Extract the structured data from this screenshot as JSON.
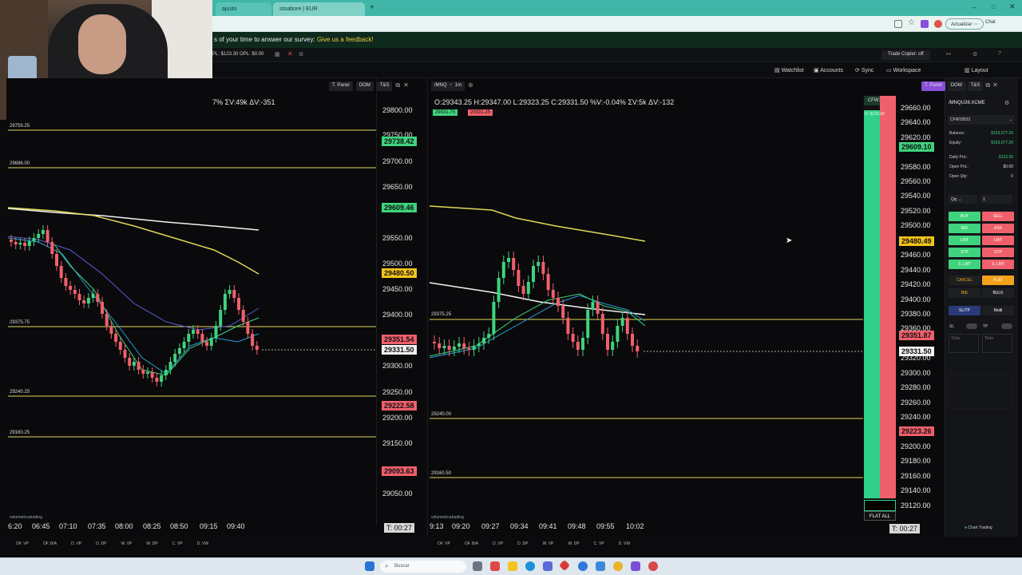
{
  "browser": {
    "tab1_label": "ajusto",
    "tab2_label": "stoabore | EUR",
    "address_buttons": [
      "Actualizar",
      "Chat"
    ]
  },
  "survey": {
    "prefix": "s of your time to answer our survey:",
    "link": "Give us a feedback!"
  },
  "topbar": {
    "opl_text": "PL: $123.30   OPL: $0.00",
    "trade_copier": "Trade Copier: off"
  },
  "toolbar": {
    "watchlist": "Watchlist",
    "accounts": "Accounts",
    "sync": "Sync",
    "workspace": "Workspace",
    "layout": "Layout"
  },
  "left_chart": {
    "tools": [
      "T. Panel",
      "DOM",
      "T&S"
    ],
    "ohlc": "7% ΣV:49k ΔV:-351",
    "yticks": [
      "29800.00",
      "29750.00",
      "29700.00",
      "29650.00",
      "29550.00",
      "29500.00",
      "29450.00",
      "29400.00",
      "29300.00",
      "29250.00",
      "29200.00",
      "29150.00",
      "29050.00"
    ],
    "badges": {
      "b1": "29738.42",
      "b2": "29609.46",
      "b3": "29480.50",
      "b4": "29351.54",
      "b5": "29331.50",
      "b6": "29222.58",
      "b7": "29093.63"
    },
    "hlines": {
      "l1": "29759.25",
      "l2": "29686.00",
      "l3": "29375.75",
      "l4": "29240.25",
      "l5": "29160.25"
    },
    "xticks": [
      "6:20",
      "06:45",
      "07:10",
      "07:35",
      "08:00",
      "08:25",
      "08:50",
      "09:15",
      "09:40"
    ],
    "timer": "T: 00:27",
    "brand": "volumetricatrading",
    "bottom": [
      "OF. VP",
      "OF. B/A",
      "D. VP",
      "D. DP",
      "W. VP",
      "W. DP",
      "C. VP",
      "D. VW"
    ]
  },
  "right_chart": {
    "symbol": "/MNQ",
    "interval": "1m",
    "ohlc": "O:29343.25  H:29347.00  L:29323.25  C:29331.50  %V:-0.04%  ΣV:5k  ΔV:-132",
    "bid": "29331.75",
    "ask": "29331.25",
    "yticks": [
      "29660.00",
      "29640.00",
      "29620.00",
      "29580.00",
      "29560.00",
      "29540.00",
      "29520.00",
      "29500.00",
      "29460.00",
      "29440.00",
      "29420.00",
      "29400.00",
      "29380.00",
      "29360.00",
      "29320.00",
      "29300.00",
      "29280.00",
      "29260.00",
      "29240.00",
      "29220.00",
      "29200.00",
      "29180.00",
      "29160.00",
      "29140.00",
      "29120.00"
    ],
    "badges": {
      "b1": "29609.10",
      "b2": "29480.49",
      "b3": "29351.87",
      "b4": "29331.50",
      "b5": "29223.26"
    },
    "hlines": {
      "l1": "29375.25",
      "l2": "29240.00",
      "l3": "29160.50"
    },
    "xticks": [
      "9:13",
      "09:20",
      "09:27",
      "09:34",
      "09:41",
      "09:48",
      "09:55",
      "10:02"
    ],
    "timer": "T: 00:27",
    "brand": "volumetricatrading",
    "bottom": [
      "OF. VP",
      "OF. B/A",
      "D. VP",
      "D. DP",
      "W. VP",
      "W. DP",
      "C. VP",
      "D. VW"
    ],
    "account_tag": "CFW18522",
    "pnl_tag": "O: $123.30",
    "flat_all": "FLAT ALL"
  },
  "trade_panel": {
    "tools": [
      "T. Panel",
      "DOM",
      "T&S"
    ],
    "symbol": "/MNQU26:XCME",
    "account": "CFW18522",
    "rows": [
      {
        "label": "Balance:",
        "value": "$153,677.26"
      },
      {
        "label": "Equity:",
        "value": "$153,677.26"
      },
      {
        "label": "Daily PnL:",
        "value": "$123.30"
      },
      {
        "label": "Open PnL:",
        "value": "$0.00"
      },
      {
        "label": "Open Qty:",
        "value": "0"
      }
    ],
    "qty_label": "Qty",
    "qty_value": "1",
    "buttons_left": [
      "BUY",
      "BID",
      "LMT",
      "STP",
      "S. LMT"
    ],
    "buttons_right": [
      "SELL",
      "ASK",
      "LMT",
      "STP",
      "S. LMT"
    ],
    "cancel": "CANCEL",
    "flat": "FLAT",
    "be": "B/E",
    "bulk": "BULK",
    "sltp": "SL/TP",
    "multi": "Multi",
    "sl": "SL",
    "tp": "TP",
    "ticks": "Ticks",
    "footer": "Chart Trading"
  },
  "taskbar": {
    "search_placeholder": "Buscar"
  },
  "colors": {
    "green": "#3fd37d",
    "red": "#f0606c",
    "yellow": "#e0d75a",
    "orange": "#f3a11b",
    "teal": "#3fb6a8"
  }
}
